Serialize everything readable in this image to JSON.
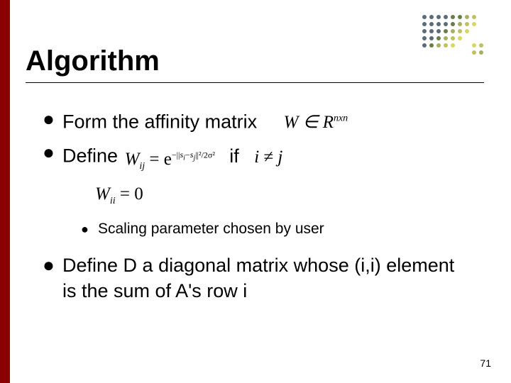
{
  "slide": {
    "title": "Algorithm",
    "page_number": "71"
  },
  "bullets": {
    "b1": "Form the affinity matrix",
    "b1_math": "W ∈ R",
    "b1_math_sup": "nxn",
    "b2": "Define",
    "b2_math_lhs": "W",
    "b2_math_sub1": "ij",
    "b2_math_eq": " = e",
    "b2_math_exp": "−||s_i−s_j||² / 2σ²",
    "b2_if": "if",
    "b2_cond_l": "i",
    "b2_cond_ne": " ≠ ",
    "b2_cond_r": "j",
    "b2_wii_l": "W",
    "b2_wii_sub": "ii",
    "b2_wii_r": " = 0",
    "sub1": "Scaling parameter chosen by user",
    "b3": "Define D a diagonal matrix whose (i,i) element is the sum of A's row i"
  }
}
